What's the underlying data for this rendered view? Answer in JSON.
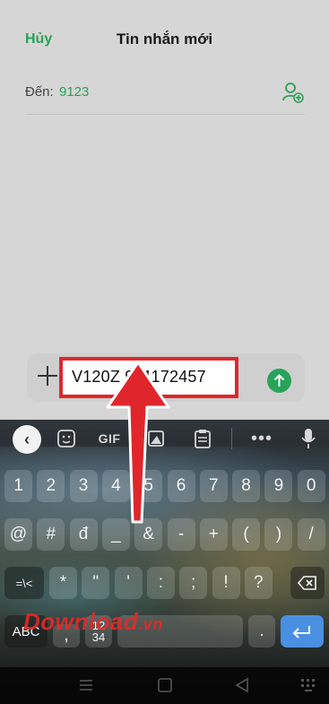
{
  "header": {
    "cancel": "Hủy",
    "title": "Tin nhắn mới"
  },
  "recipient": {
    "label": "Đến:",
    "value": "9123",
    "add_icon": "add-contact-icon"
  },
  "compose": {
    "message": "V120Z 971172457",
    "send_icon": "send-arrow-icon",
    "attach_icon": "plus-icon"
  },
  "toolbar": {
    "gif": "GIF"
  },
  "keyboard": {
    "row_numbers": [
      "1",
      "2",
      "3",
      "4",
      "5",
      "6",
      "7",
      "8",
      "9",
      "0"
    ],
    "row_symbols1": [
      "@",
      "#",
      "đ",
      "_",
      "&",
      "-",
      "+",
      "(",
      ")",
      "/"
    ],
    "row_symbols2": [
      "=\\<",
      "*",
      "\"",
      "'",
      ":",
      ";",
      "!",
      "?"
    ],
    "row_bottom": {
      "abc": "ABC",
      "comma": ",",
      "numpad_top": "12",
      "numpad_bottom": "34",
      "period": "."
    }
  },
  "watermark": {
    "main": "Download",
    "suffix": ".vn"
  },
  "colors": {
    "accent_green": "#2aa255",
    "highlight_red": "#e0262b",
    "enter_blue": "#4a90e2"
  }
}
